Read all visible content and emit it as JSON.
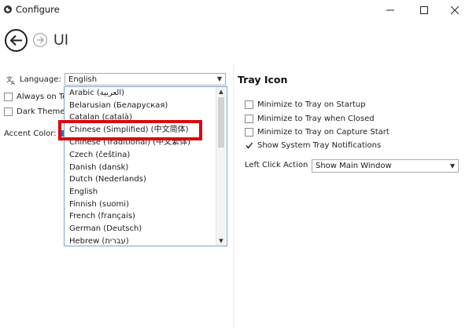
{
  "window": {
    "title": "Configure",
    "app_icon": "app-logo-icon",
    "controls": [
      "minimize-icon",
      "maximize-icon",
      "close-icon"
    ]
  },
  "header": {
    "back_icon": "arrow-left-icon",
    "forward_icon": "arrow-right-icon",
    "page_title": "UI"
  },
  "left_pane": {
    "language_label": "Language:",
    "language_icon": "translate-icon",
    "language_value": "English",
    "always_on_top_label": "Always on To",
    "dark_theme_label": "Dark Theme",
    "accent_color_label": "Accent Color:",
    "accent_color": "#0a7bd2"
  },
  "language_dropdown": {
    "options": [
      "Arabic (العربية)",
      "Belarusian (Беларуская)",
      "Catalan (català)",
      "Chinese (Simplified) (中文简体)",
      "Chinese (Traditional) (中文繁体)",
      "Czech (čeština)",
      "Danish (dansk)",
      "Dutch (Nederlands)",
      "English",
      "Finnish (suomi)",
      "French (français)",
      "German (Deutsch)",
      "Hebrew (עברית)"
    ],
    "highlighted_option": "Chinese (Simplified) (中文简体)",
    "highlight_color": "#e0000c"
  },
  "tray": {
    "heading": "Tray Icon",
    "options": [
      {
        "label": "Minimize to Tray on Startup",
        "checked": false
      },
      {
        "label": "Minimize to Tray when Closed",
        "checked": false
      },
      {
        "label": "Minimize to Tray on Capture Start",
        "checked": false
      },
      {
        "label": "Show System Tray Notifications",
        "checked": true
      }
    ],
    "left_click_label": "Left Click Action",
    "left_click_value": "Show Main Window"
  }
}
